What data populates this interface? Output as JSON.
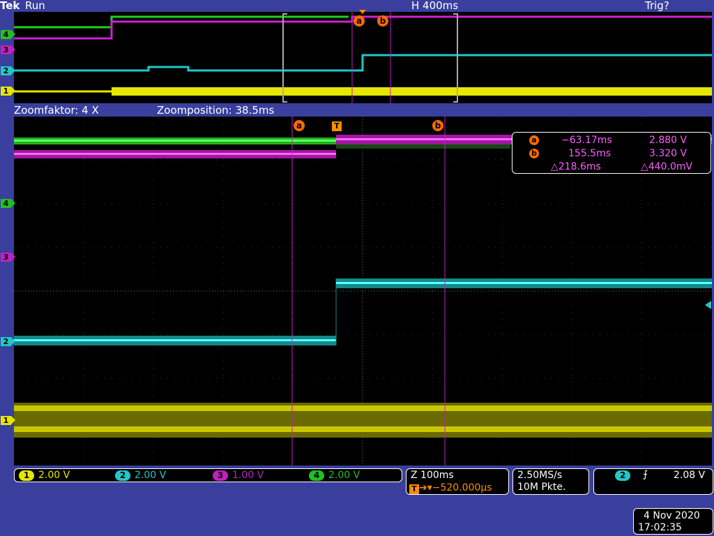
{
  "header": {
    "brand": "Tek",
    "run_state": "Run",
    "horizontal_scale": "H 400ms",
    "trigger_status": "Trig?"
  },
  "zoom_bar": {
    "zoom_factor": "Zoomfaktor: 4 X",
    "zoom_position": "Zoomposition: 38.5ms"
  },
  "channel_markers": [
    "1",
    "2",
    "3",
    "4"
  ],
  "cursors": {
    "a_label": "a",
    "b_label": "b",
    "trigger_label": "T"
  },
  "cursor_readout": {
    "a_time": "−63.17ms",
    "a_volt": "2.880 V",
    "b_time": "155.5ms",
    "b_volt": "3.320 V",
    "delta_time": "△218.6ms",
    "delta_volt": "△440.0mV"
  },
  "channels": [
    {
      "num": "1",
      "scale": "2.00 V",
      "color": "#e6e600"
    },
    {
      "num": "2",
      "scale": "2.00 V",
      "color": "#20c8c8"
    },
    {
      "num": "3",
      "scale": "1.00 V",
      "color": "#c020c0"
    },
    {
      "num": "4",
      "scale": "2.00 V",
      "color": "#20c020"
    }
  ],
  "timebase": {
    "zoom_scale": "Z 100ms",
    "trigger_delay": "−520.000µs"
  },
  "acquisition": {
    "sample_rate": "2.50MS/s",
    "record_length": "10M Pkte."
  },
  "trigger": {
    "source": "2",
    "level": "2.08 V"
  },
  "datetime": {
    "date": "4 Nov 2020",
    "time": "17:02:35"
  },
  "colors": {
    "ch1": "#e6e600",
    "ch2": "#20c8c8",
    "ch3": "#d020d0",
    "ch4": "#20d020",
    "cursor": "#ff6a00",
    "background": "#3a3f9e"
  }
}
